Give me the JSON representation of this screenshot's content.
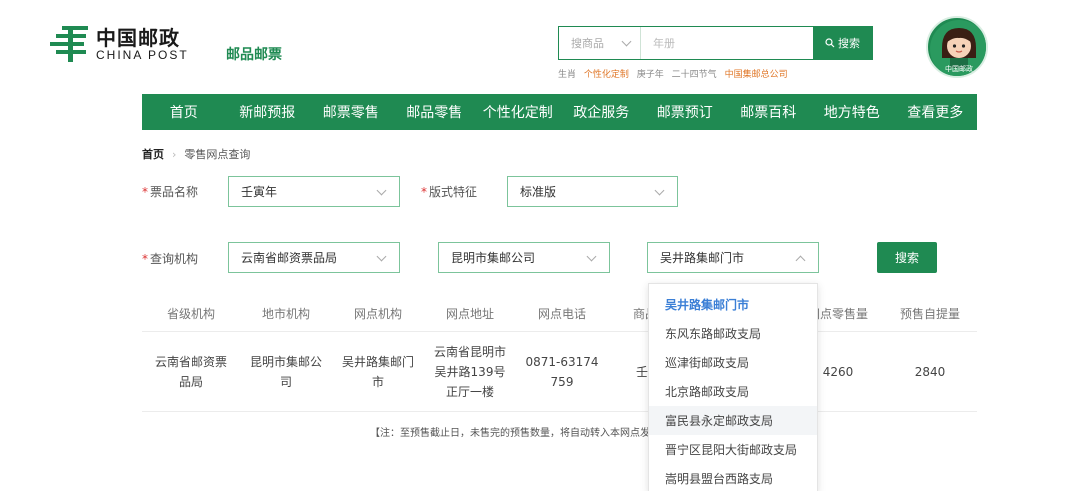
{
  "header": {
    "logo_cn": "中国邮政",
    "logo_en": "CHINA POST",
    "site_tag": "邮品邮票",
    "search": {
      "category": "搜商品",
      "placeholder": "年册",
      "button": "搜索"
    },
    "hot_words": [
      "生肖",
      "个性化定制",
      "庚子年",
      "二十四节气",
      "中国集邮总公司"
    ],
    "mascot_label": "中国邮政"
  },
  "nav": [
    "首页",
    "新邮预报",
    "邮票零售",
    "邮品零售",
    "个性化定制",
    "政企服务",
    "邮票预订",
    "邮票百科",
    "地方特色",
    "查看更多"
  ],
  "breadcrumb": {
    "home": "首页",
    "current": "零售网点查询"
  },
  "form": {
    "product_label": "票品名称",
    "product_value": "壬寅年",
    "format_label": "版式特征",
    "format_value": "标准版",
    "org_label": "查询机构",
    "province": "云南省邮资票品局",
    "city": "昆明市集邮公司",
    "outlet": "吴井路集邮门市",
    "search_button": "搜索"
  },
  "table": {
    "headers": [
      "省级机构",
      "地市机构",
      "网点机构",
      "网点地址",
      "网点电话",
      "商品",
      "网点零售量",
      "预售自提量"
    ],
    "row": {
      "province": "云南省邮资票品局",
      "city": "昆明市集邮公司",
      "outlet": "吴井路集邮门市",
      "address": "云南省昆明市吴井路139号正厅一楼",
      "phone": "0871-63174759",
      "product": "壬",
      "retail": "4260",
      "presale": "2840"
    },
    "note": "【注：至预售截止日，未售完的预售数量，将自动转入本网点发"
  },
  "dropdown": {
    "items": [
      "吴井路集邮门市",
      "东风东路邮政支局",
      "巡津街邮政支局",
      "北京路邮政支局",
      "富民县永定邮政支局",
      "晋宁区昆阳大街邮政支局",
      "嵩明县盟台西路支局"
    ],
    "active_index": 0,
    "hover_index": 4
  },
  "colors": {
    "brand": "#1f8a52",
    "accent": "#e0782a",
    "active": "#3b7fd6"
  }
}
